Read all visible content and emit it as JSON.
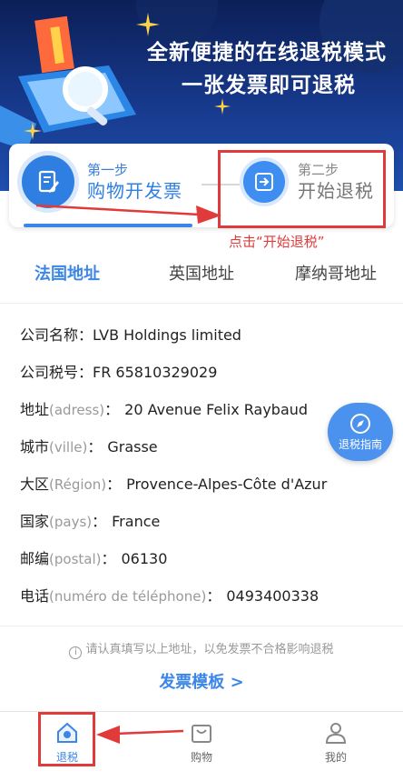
{
  "banner": {
    "title": "全新便捷的在线退税模式",
    "subtitle": "一张发票即可退税"
  },
  "steps": [
    {
      "label": "第一步",
      "title": "购物开发票",
      "icon": "edit-document-icon"
    },
    {
      "label": "第二步",
      "title": "开始退税",
      "icon": "enter-arrow-icon"
    }
  ],
  "annotation": "点击“开始退税”",
  "tabs": [
    "法国地址",
    "英国地址",
    "摩纳哥地址"
  ],
  "address": {
    "company_name": {
      "label": "公司名称：",
      "value": "LVB Holdings limited"
    },
    "tax_id": {
      "label": "公司税号：",
      "value": "FR 65810329029"
    },
    "street": {
      "label": "地址",
      "hint": "(adress)",
      "sep": "：",
      "value": "20 Avenue Felix Raybaud"
    },
    "city": {
      "label": "城市",
      "hint": "(ville)",
      "sep": "：",
      "value": "Grasse"
    },
    "region": {
      "label": "大区",
      "hint": "(Région)",
      "sep": "：",
      "value": "Provence-Alpes-Côte d'Azur"
    },
    "country": {
      "label": "国家",
      "hint": "(pays)",
      "sep": "：",
      "value": "France"
    },
    "postal": {
      "label": "邮编",
      "hint": "(postal)",
      "sep": "：",
      "value": "06130"
    },
    "phone": {
      "label": "电话",
      "hint": "(numéro de téléphone)",
      "sep": "：",
      "value": "0493400338"
    }
  },
  "guide_button": "退税指南",
  "notice": "请认真填写以上地址，以免发票不合格影响退税",
  "template_link": "发票模板 >",
  "nav": [
    {
      "label": "退税",
      "icon": "home-icon"
    },
    {
      "label": "购物",
      "icon": "shopping-bag-icon"
    },
    {
      "label": "我的",
      "icon": "user-icon"
    }
  ],
  "colors": {
    "accent": "#3b86e6",
    "annotation": "#e03a3a",
    "banner": "#17398c"
  }
}
